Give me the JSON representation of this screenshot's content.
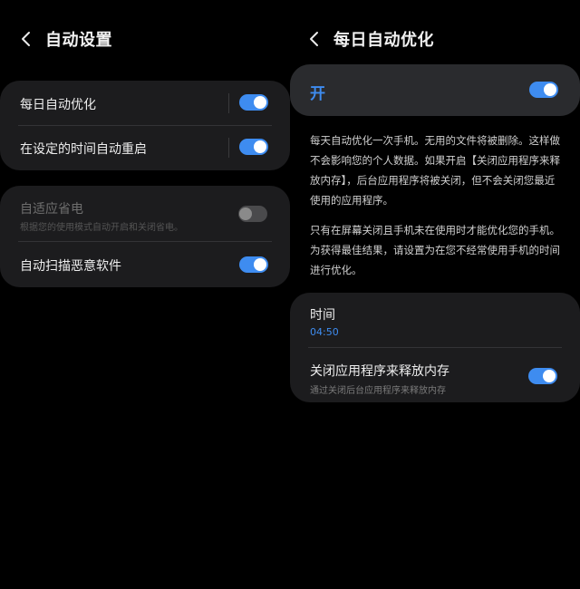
{
  "left": {
    "title": "自动设置",
    "card1": [
      {
        "label": "每日自动优化",
        "on": true
      },
      {
        "label": "在设定的时间自动重启",
        "on": true
      }
    ],
    "card2": {
      "adaptive": {
        "label": "自适应省电",
        "sub": "根据您的使用模式自动开启和关闭省电。",
        "on": false
      },
      "scan": {
        "label": "自动扫描恶意软件",
        "on": true
      }
    }
  },
  "right": {
    "title": "每日自动优化",
    "master": {
      "label": "开",
      "on": true
    },
    "desc1": "每天自动优化一次手机。无用的文件将被删除。这样做不会影响您的个人数据。如果开启【关闭应用程序来释放内存】，后台应用程序将被关闭，但不会关闭您最近使用的应用程序。",
    "desc2": "只有在屏幕关闭且手机未在使用时才能优化您的手机。为获得最佳结果，请设置为在您不经常使用手机的时间进行优化。",
    "time": {
      "label": "时间",
      "value": "04:50"
    },
    "free_memory": {
      "label": "关闭应用程序来释放内存",
      "sub": "通过关闭后台应用程序来释放内存",
      "on": true
    }
  },
  "colors": {
    "accent": "#3e8cf0",
    "card": "#1c1c1e",
    "background": "#000000"
  }
}
